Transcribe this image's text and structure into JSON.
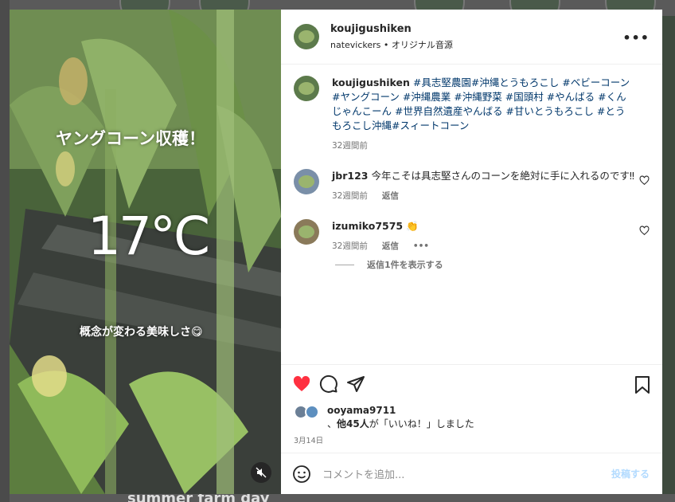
{
  "post": {
    "username": "koujigushiken",
    "audio_line": "natevickers • オリジナル音源",
    "overlay_title": "ヤングコーン収穫！",
    "overlay_temp": "17°C",
    "overlay_sub": "概念が変わる美味しさ😋",
    "more_label": "•••"
  },
  "caption": {
    "username": "koujigushiken",
    "text": "#具志堅農園#沖縄とうもろこし #ベビーコーン #ヤングコーン #沖縄農業 #沖縄野菜 #国頭村 #やんばる #くんじゃんこーん #世界自然遺産やんばる #甘いとうもろこし #とうもろこし沖縄#スィートコーン",
    "time": "32週間前"
  },
  "comments": [
    {
      "username": "jbr123",
      "text": "今年こそは具志堅さんのコーンを絶対に手に入れるのです‼",
      "time": "32週間前",
      "reply_label": "返信"
    },
    {
      "username": "izumiko7575",
      "text": "👏",
      "time": "32週間前",
      "reply_label": "返信",
      "more": "•••",
      "view_replies": "返信1件を表示する"
    }
  ],
  "likes": {
    "user": "ooyama9711",
    "line_prefix": "、",
    "others": "他45人",
    "line_suffix": "が「いいね！」しました",
    "date": "3月14日"
  },
  "composer": {
    "placeholder": "コメントを追加...",
    "post_label": "投稿する"
  },
  "background": {
    "bottom_text": "summer farm day"
  },
  "colors": {
    "like_red": "#ff3040",
    "hashtag_blue": "#00376b",
    "post_button": "#b3dbff"
  },
  "icons": [
    "more-icon",
    "heart-icon",
    "comment-icon",
    "share-icon",
    "bookmark-icon",
    "emoji-icon",
    "mute-icon"
  ]
}
